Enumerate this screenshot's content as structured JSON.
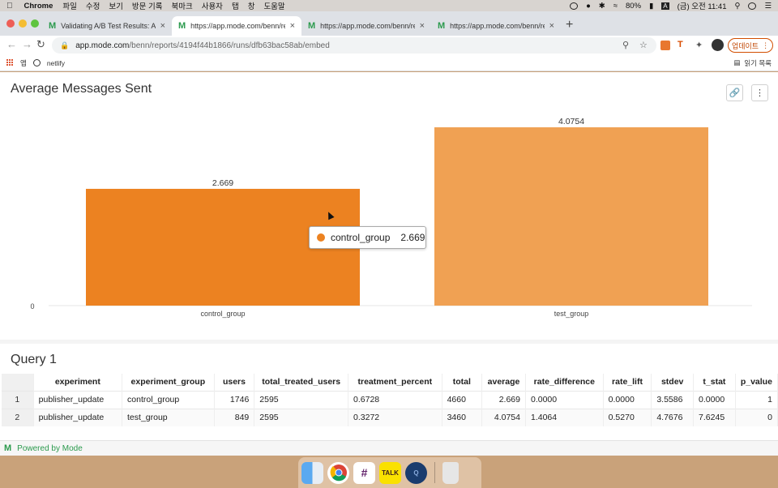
{
  "menubar": {
    "app": "Chrome",
    "items": [
      "파일",
      "수정",
      "보기",
      "방문 기록",
      "북마크",
      "사용자",
      "탭",
      "창",
      "도움말"
    ],
    "battery": "80%",
    "input_method": "A",
    "clock": "(금) 오전 11:41"
  },
  "tabs": [
    {
      "title": "Validating A/B Test Results: An",
      "active": false
    },
    {
      "title": "https://app.mode.com/benn/re",
      "active": true
    },
    {
      "title": "https://app.mode.com/benn/re",
      "active": false
    },
    {
      "title": "https://app.mode.com/benn/re",
      "active": false
    }
  ],
  "address": {
    "host": "app.mode.com",
    "path": "/benn/reports/4194f44b1866/runs/dfb63bac58ab/embed"
  },
  "update_button": "업데이트",
  "bookmarks": {
    "apps": "앱",
    "items": [
      "netlify"
    ],
    "reading_list": "읽기 목록"
  },
  "chart": {
    "title": "Average Messages Sent",
    "tooltip_label": "control_group",
    "tooltip_value": "2.669"
  },
  "chart_data": {
    "type": "bar",
    "title": "Average Messages Sent",
    "categories": [
      "control_group",
      "test_group"
    ],
    "values": [
      2.669,
      4.0754
    ],
    "value_labels": [
      "2.669",
      "4.0754"
    ],
    "colors": [
      "#ec8221",
      "#f0a153"
    ],
    "ylim": [
      0,
      4.28
    ],
    "y_ticks": [
      "0"
    ],
    "xlabel": "",
    "ylabel": ""
  },
  "query": {
    "title": "Query 1",
    "columns": [
      "",
      "experiment",
      "experiment_group",
      "users",
      "total_treated_users",
      "treatment_percent",
      "total",
      "average",
      "rate_difference",
      "rate_lift",
      "stdev",
      "t_stat",
      "p_value"
    ],
    "rows": [
      [
        "1",
        "publisher_update",
        "control_group",
        "1746",
        "2595",
        "0.6728",
        "4660",
        "2.669",
        "0.0000",
        "0.0000",
        "3.5586",
        "0.0000",
        "1"
      ],
      [
        "2",
        "publisher_update",
        "test_group",
        "849",
        "2595",
        "0.3272",
        "3460",
        "4.0754",
        "1.4064",
        "0.5270",
        "4.7676",
        "7.6245",
        "0"
      ]
    ]
  },
  "footer": "Powered by Mode",
  "dock": [
    "Finder",
    "Chrome",
    "Slack",
    "KakaoTalk",
    "QuickTime",
    "Trash"
  ]
}
